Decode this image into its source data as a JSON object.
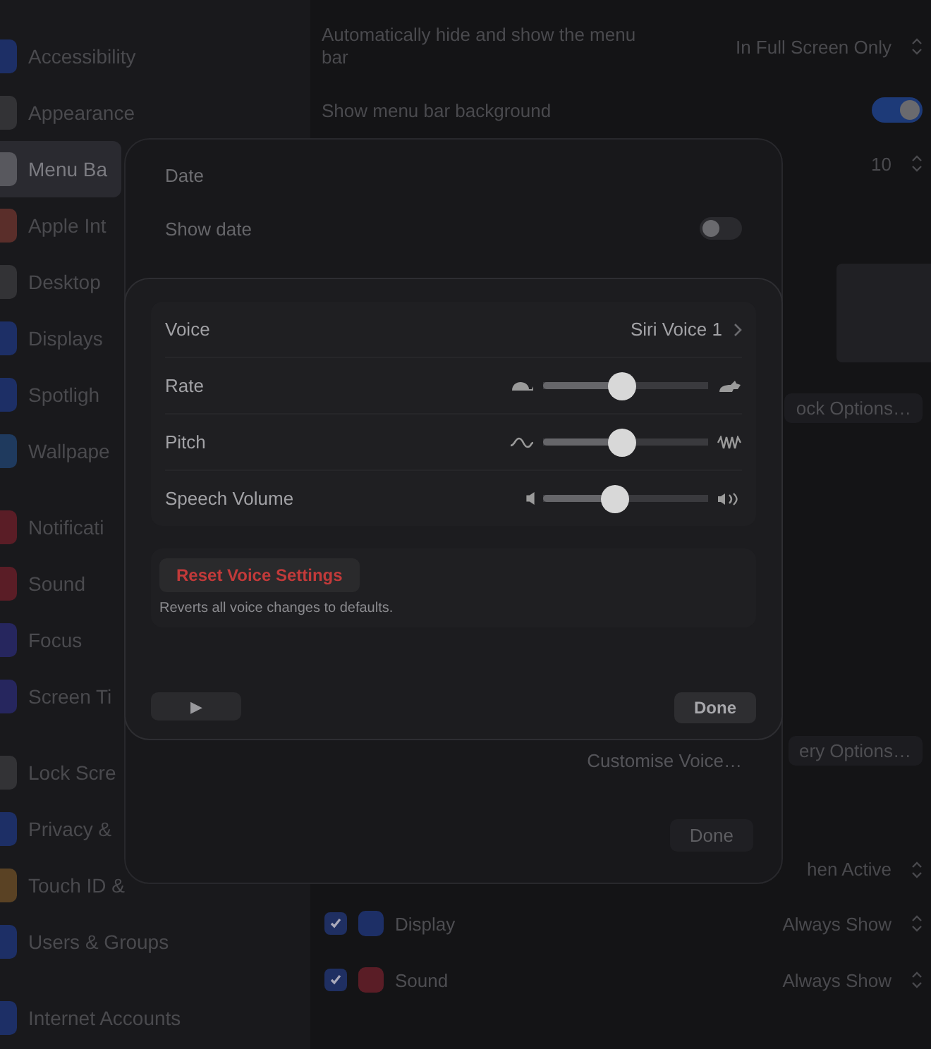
{
  "sidebar": {
    "groups": [
      {
        "items": [
          {
            "label": "Accessibility",
            "selected": false,
            "color": "#1d2f66"
          },
          {
            "label": "Appearance",
            "selected": false,
            "color": "#333336"
          },
          {
            "label": "Menu Ba",
            "selected": true,
            "color": "#58585e"
          },
          {
            "label": "Apple Int",
            "selected": false,
            "color": "#5a2e2a"
          },
          {
            "label": "Desktop",
            "selected": false,
            "color": "#333336"
          },
          {
            "label": "Displays",
            "selected": false,
            "color": "#1d2f66"
          },
          {
            "label": "Spotligh",
            "selected": false,
            "color": "#1d2f66"
          },
          {
            "label": "Wallpape",
            "selected": false,
            "color": "#1f3a5e"
          }
        ]
      },
      {
        "items": [
          {
            "label": "Notificati",
            "selected": false,
            "color": "#5a1d26"
          },
          {
            "label": "Sound",
            "selected": false,
            "color": "#5a1d26"
          },
          {
            "label": "Focus",
            "selected": false,
            "color": "#26265e"
          },
          {
            "label": "Screen Ti",
            "selected": false,
            "color": "#26265e"
          }
        ]
      },
      {
        "items": [
          {
            "label": "Lock Scre",
            "selected": false,
            "color": "#333336"
          },
          {
            "label": "Privacy &",
            "selected": false,
            "color": "#1d2f66"
          },
          {
            "label": "Touch ID &",
            "selected": false,
            "color": "#5a4224"
          },
          {
            "label": "Users & Groups",
            "selected": false,
            "color": "#1d2f66"
          }
        ]
      },
      {
        "items": [
          {
            "label": "Internet Accounts",
            "selected": false,
            "color": "#1d2f66"
          }
        ]
      }
    ]
  },
  "menu_bar_settings": [
    {
      "kind": "popup",
      "label": "Automatically hide and show the menu bar",
      "value": "In Full Screen Only"
    },
    {
      "kind": "toggle",
      "label": "Show menu bar background",
      "on": true
    },
    {
      "kind": "stepper",
      "value": "10"
    }
  ],
  "clock_button": "ock Options…",
  "customise_button": "Customise Voice…",
  "battery_button": "ery Options…",
  "when_active": "hen Active",
  "control_items": [
    {
      "label": "Display",
      "checked": true,
      "color": "#1d2f66",
      "value": "Always Show"
    },
    {
      "label": "Sound",
      "checked": true,
      "color": "#5a1d26",
      "value": "Always Show"
    }
  ],
  "date_dialog": {
    "title": "Date",
    "rows": [
      {
        "label": "Show date",
        "on": false
      }
    ],
    "done": "Done"
  },
  "voice_dialog": {
    "voice_label": "Voice",
    "voice_value": "Siri Voice 1",
    "sliders": [
      {
        "kind": "rate",
        "label": "Rate",
        "level": 0.48
      },
      {
        "kind": "pitch",
        "label": "Pitch",
        "level": 0.48
      },
      {
        "kind": "volume",
        "label": "Speech Volume",
        "level": 0.44
      }
    ],
    "reset": "Reset Voice Settings",
    "note": "Reverts all voice changes to defaults.",
    "play": "▶",
    "done": "Done"
  }
}
